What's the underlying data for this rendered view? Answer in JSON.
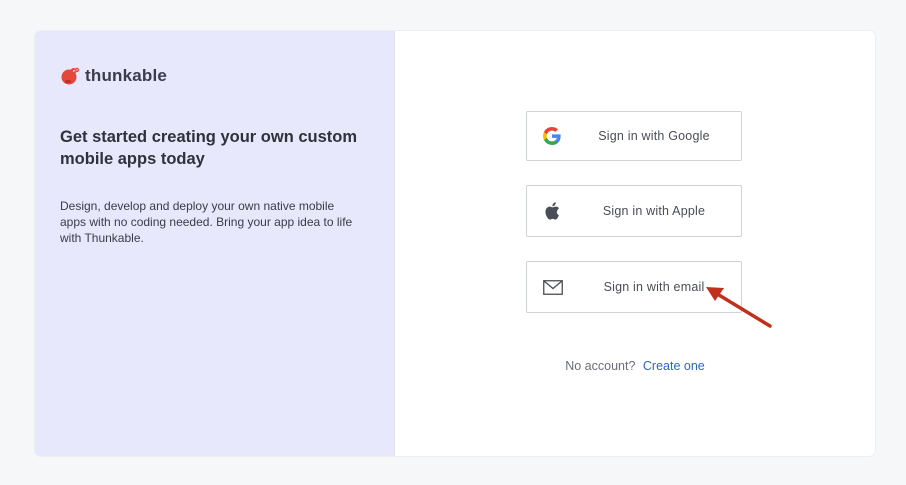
{
  "brand": {
    "name": "thunkable",
    "logo_icon": "thunkable-beaver-logo"
  },
  "left": {
    "headline": "Get started creating your own custom mobile apps today",
    "description": "Design, develop and deploy your own native mobile apps with no coding needed. Bring your app idea to life with Thunkable."
  },
  "signin": {
    "google_label": "Sign in with Google",
    "google_icon": "google-g-icon",
    "apple_label": "Sign in with Apple",
    "apple_icon": "apple-icon",
    "email_label": "Sign in with email",
    "email_icon": "envelope-icon"
  },
  "footer": {
    "no_account_text": "No account?",
    "create_link": "Create one"
  },
  "colors": {
    "left_panel_bg": "#e7e8fb",
    "link": "#2f63c9",
    "annotation_arrow": "#c0301a",
    "brand_red": "#e5483b"
  }
}
